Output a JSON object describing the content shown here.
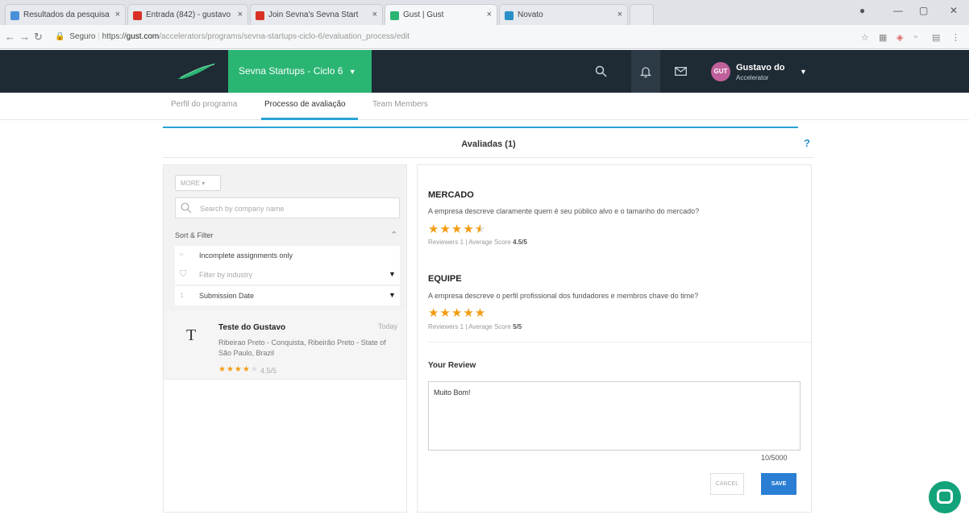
{
  "browser": {
    "tabs": [
      {
        "title": "Resultados da pesquisa",
        "color": "#4a90d9"
      },
      {
        "title": "Entrada (842) - gustavo",
        "color": "#d93025"
      },
      {
        "title": "Join Sevna's Sevna Start",
        "color": "#d93025"
      },
      {
        "title": "Gust | Gust",
        "color": "#2ab573"
      },
      {
        "title": "Novato",
        "color": "#2a90c8"
      }
    ],
    "url_secure_label": "Seguro",
    "url_scheme": "https://",
    "url_host": "gust.com",
    "url_path": "/accelerators/programs/sevna-startups-ciclo-6/evaluation_process/edit"
  },
  "header": {
    "program_label": "Sevna Startups - Ciclo 6",
    "user_name": "Gustavo do",
    "user_role": "Accelerator",
    "avatar_initials": "GUT"
  },
  "subnav": {
    "tabs": [
      "Perfil do programa",
      "Processo de avaliação",
      "Team Members"
    ]
  },
  "tab_header": {
    "title": "Avaliadas (1)",
    "help": "?"
  },
  "left": {
    "dropdown_label": "MORE",
    "search_placeholder": "Search by company name",
    "sort_filter_label": "Sort & Filter",
    "filters": [
      {
        "label": "Incomplete assignments only",
        "muted": false
      },
      {
        "label": "Filter by industry",
        "muted": true
      },
      {
        "label": "Submission Date",
        "muted": false
      }
    ],
    "company": {
      "initial": "T",
      "name": "Teste do Gustavo",
      "date": "Today",
      "location": "Ribeirao Preto - Conquista, Ribeirão Preto - State of São Paulo, Brazil",
      "rating": 4.5,
      "score": "4.5/5"
    }
  },
  "right": {
    "sections": [
      {
        "title": "MERCADO",
        "question": "A empresa descreve claramente quem é seu público alvo e o tamanho do mercado?",
        "rating": 4.5,
        "meta_prefix": "Reviewers 1 | Average Score",
        "score": "4.5/5"
      },
      {
        "title": "EQUIPE",
        "question": "A empresa descreve o perfil profissional dos fundadores e membros chave do time?",
        "rating": 5,
        "meta_prefix": "Reviewers 1 | Average Score",
        "score": "5/5"
      }
    ],
    "review_label": "Your Review",
    "review_text": "Muito Bom!",
    "counter": "10/5000",
    "cancel_label": "CANCEL",
    "save_label": "SAVE"
  }
}
